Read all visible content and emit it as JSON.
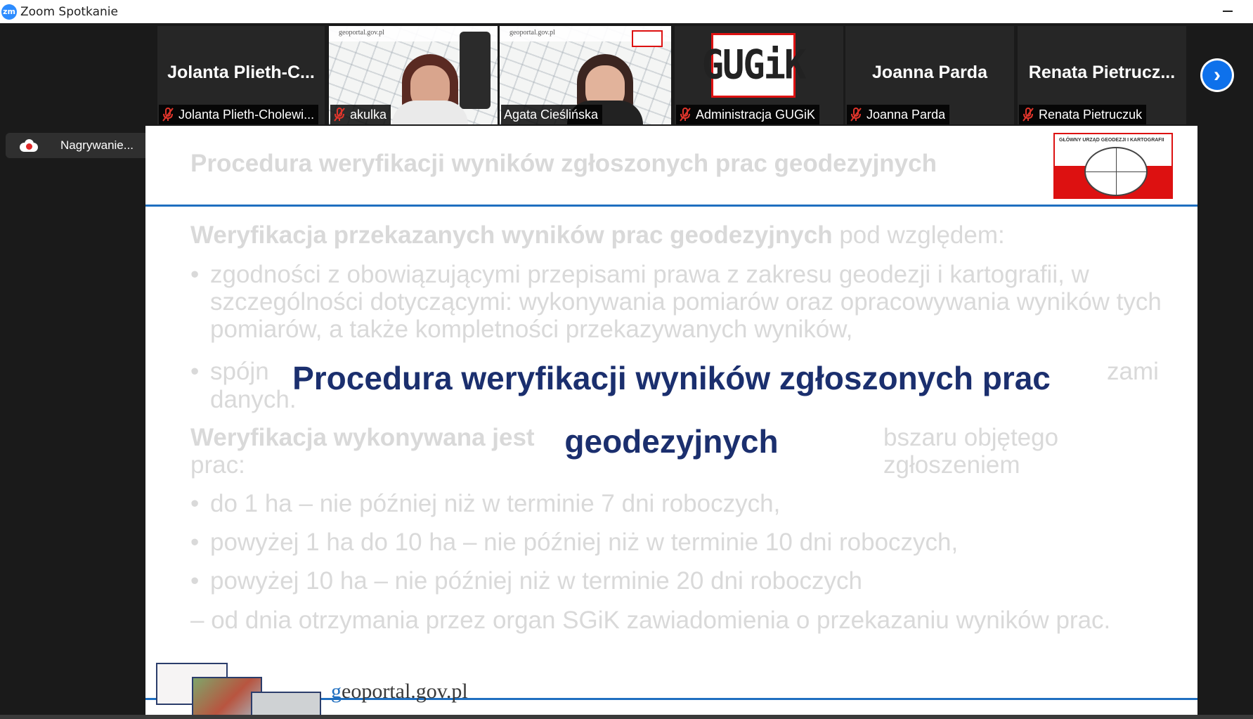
{
  "window": {
    "title": "Zoom Spotkanie",
    "logo_text": "zm"
  },
  "gallery": {
    "tiles": [
      {
        "big_name": "Jolanta  Plieth-C...",
        "caption": "Jolanta Plieth-Cholewi..."
      },
      {
        "caption": "akulka"
      },
      {
        "caption": "Agata Cieślińska"
      },
      {
        "caption": "Administracja GUGiK",
        "logo_text": "GUGiK"
      },
      {
        "big_name": "Joanna Parda",
        "caption": "Joanna Parda"
      },
      {
        "big_name": "Renata  Pietrucz...",
        "caption": "Renata Pietruczuk"
      }
    ],
    "video_header_text": "geoportal.gov.pl"
  },
  "recording": {
    "label": "Nagrywanie..."
  },
  "slide": {
    "bg_title": "Procedura weryfikacji wyników zgłoszonych prac geodezyjnych",
    "logo_text": "GŁÓWNY URZĄD GEODEZJI I KARTOGRAFII",
    "para1_bold": "Weryfikacja przekazanych wyników prac geodezyjnych",
    "para1_rest": " pod względem:",
    "bullet1": "zgodności z obowiązującymi przepisami prawa z zakresu geodezji i kartografii, w szczególności dotyczącymi: wykonywania pomiarów oraz opracowywania wyników tych pomiarów, a także kompletności przekazywanych wyników,",
    "bullet2_start": "spójn",
    "bullet2_end": "zami",
    "bullet2_line2": "danych.",
    "para2_bold": "Weryfikacja wykonywana jest ",
    "para2_rest": "bszaru objętego zgłoszeniem",
    "para2_line2": "prac:",
    "items": [
      "do 1 ha – nie później niż w terminie 7 dni roboczych,",
      "powyżej 1 ha do 10 ha – nie później niż w terminie 10 dni roboczych,",
      "powyżej 10 ha – nie później niż w terminie 20 dni roboczych"
    ],
    "closing": "– od dnia otrzymania przez organ SGiK zawiadomienia o przekazaniu wyników prac.",
    "overlay_line1": "Procedura weryfikacji wyników zgłoszonych prac",
    "overlay_line2": "geodezyjnych",
    "footer_brand_g": "g",
    "footer_brand_rest": "eoportal.gov.pl"
  }
}
